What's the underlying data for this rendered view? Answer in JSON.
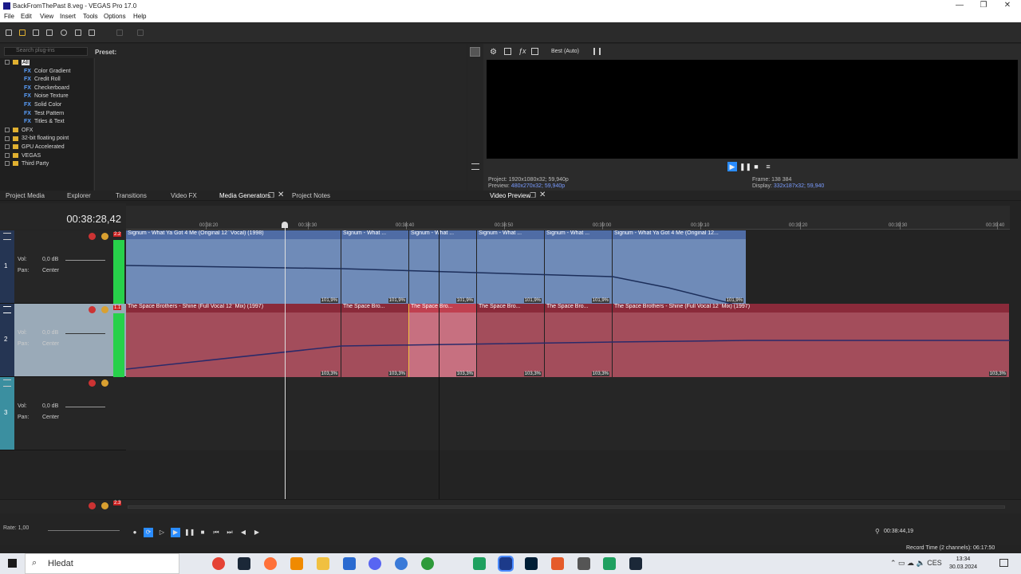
{
  "window": {
    "title": "BackFromThePast 8.veg - VEGAS Pro 17.0",
    "controls": [
      "—",
      "❐",
      "✕"
    ]
  },
  "menu": [
    "File",
    "Edit",
    "View",
    "Insert",
    "Tools",
    "Options",
    "Help"
  ],
  "fx_browser": {
    "search_placeholder": "Search plug-ins",
    "preset_label": "Preset:",
    "tree": [
      {
        "label": "All",
        "type": "folder",
        "level": 0
      },
      {
        "label": "Color Gradient",
        "type": "fx",
        "level": 1
      },
      {
        "label": "Credit Roll",
        "type": "fx",
        "level": 1
      },
      {
        "label": "Checkerboard",
        "type": "fx",
        "level": 1
      },
      {
        "label": "Noise Texture",
        "type": "fx",
        "level": 1
      },
      {
        "label": "Solid Color",
        "type": "fx",
        "level": 1
      },
      {
        "label": "Test Pattern",
        "type": "fx",
        "level": 1
      },
      {
        "label": "Titles & Text",
        "type": "fx",
        "level": 1
      },
      {
        "label": "OFX",
        "type": "folder",
        "level": 0
      },
      {
        "label": "32-bit floating point",
        "type": "folder",
        "level": 0
      },
      {
        "label": "GPU Accelerated",
        "type": "folder",
        "level": 0
      },
      {
        "label": "VEGAS",
        "type": "folder",
        "level": 0
      },
      {
        "label": "Third Party",
        "type": "folder",
        "level": 0
      }
    ]
  },
  "dock_tabs": [
    "Project Media",
    "Explorer",
    "Transitions",
    "Video FX",
    "Media Generators",
    "Project Notes"
  ],
  "preview": {
    "quality": "Best (Auto)",
    "project_label": "Project:",
    "project_value": "1920x1080x32; 59,940p",
    "preview_label": "Preview:",
    "preview_value": "480x270x32; 59,940p",
    "frame_label": "Frame:",
    "frame_value": "138 384",
    "display_label": "Display:",
    "display_value": "332x187x32; 59,940",
    "tab_label": "Video Preview"
  },
  "timeline": {
    "timecode": "00:38:28,42",
    "ruler_labels": [
      "00:38:20",
      "00:38:30",
      "00:38:40",
      "00:38:50",
      "00:39:00",
      "00:39:10",
      "00:39:20",
      "00:39:30",
      "00:39:40"
    ],
    "tracks": [
      {
        "num": "1",
        "vol_label": "Vol:",
        "vol_value": "0,0 dB",
        "pan_label": "Pan:",
        "pan_value": "Center",
        "meter_peak": "2.2",
        "clips": [
          {
            "title": "Signum - What Ya Got 4 Me (Original 12 ̈  Vocal) (1998)",
            "pct": "101,9%"
          },
          {
            "title": "Signum - What ...",
            "pct": "101,9%"
          },
          {
            "title": "Signum - What ...",
            "pct": "101,9%"
          },
          {
            "title": "Signum - What ...",
            "pct": "101,9%"
          },
          {
            "title": "Signum - What ...",
            "pct": "101,9%"
          },
          {
            "title": "Signum - What Ya Got 4 Me (Original 12...",
            "pct": "101,9%"
          }
        ]
      },
      {
        "num": "2",
        "vol_label": "Vol:",
        "vol_value": "0,0 dB",
        "pan_label": "Pan:",
        "pan_value": "Center",
        "meter_peak": "1.1",
        "clips": [
          {
            "title": "The Space Brothers - Shine (Full Vocal 12 ̈  Mix) (1997)",
            "pct": "103,3%"
          },
          {
            "title": "The Space Bro...",
            "pct": "103,3%"
          },
          {
            "title": "The Space Bro...",
            "pct": "103,3%"
          },
          {
            "title": "The Space Bro...",
            "pct": "103,3%"
          },
          {
            "title": "The Space Bro...",
            "pct": "103,3%"
          },
          {
            "title": "The Space Brothers - Shine (Full Vocal 12 ̈  Mix) (1997)",
            "pct": "103,3%"
          }
        ]
      },
      {
        "num": "3",
        "vol_label": "Vol:",
        "vol_value": "0,0 dB",
        "pan_label": "Pan:",
        "pan_value": "Center"
      }
    ],
    "bus_peak": "2.3"
  },
  "transport": {
    "rate": "Rate: 1,00",
    "location": "00:38:44,19",
    "record_time": "Record Time (2 channels): 06:17:50"
  },
  "taskbar": {
    "search": "Hledat",
    "lang": "CES",
    "time": "13:34",
    "date": "30.03.2024"
  },
  "colors": {
    "audio_blue": "#6f8bb8",
    "audio_red": "#a34d5b",
    "meter_green": "#27d14a",
    "play_blue": "#2a8cff"
  }
}
